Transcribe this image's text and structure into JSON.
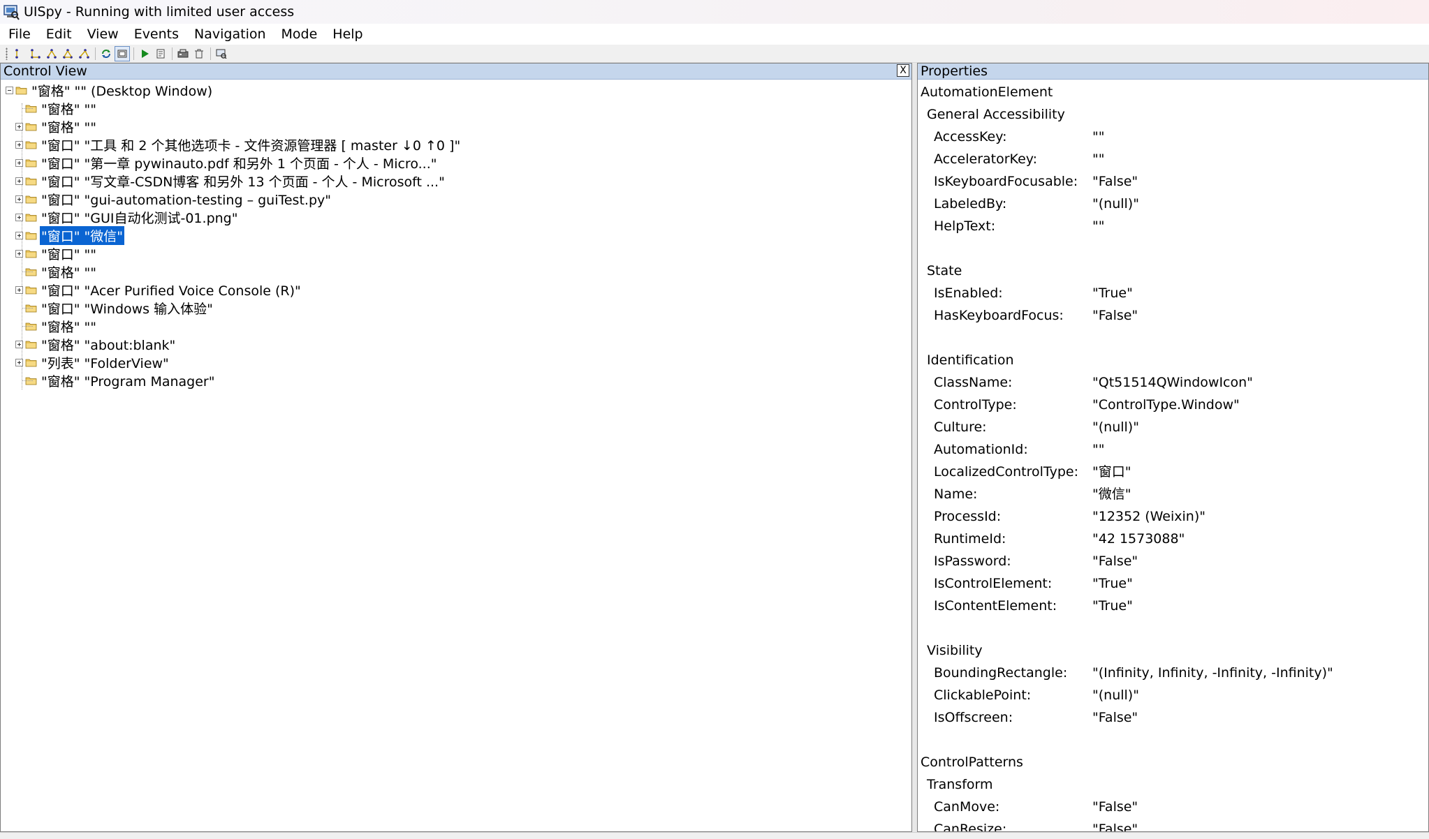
{
  "window": {
    "title": "UISpy - Running with limited user access"
  },
  "menu": [
    "File",
    "Edit",
    "View",
    "Events",
    "Navigation",
    "Mode",
    "Help"
  ],
  "control_view": {
    "header": "Control View",
    "close_label": "X",
    "tree": [
      {
        "label": "\"窗格\" \"\" (Desktop Window)",
        "level": 0,
        "expander": "minus"
      },
      {
        "label": "\"窗格\" \"\"",
        "level": 1,
        "expander": "none"
      },
      {
        "label": "\"窗格\" \"\"",
        "level": 1,
        "expander": "plus"
      },
      {
        "label": "\"窗口\" \"工具 和 2 个其他选项卡 - 文件资源管理器 [ master ↓0 ↑0 ]\"",
        "level": 1,
        "expander": "plus"
      },
      {
        "label": "\"窗口\" \"第一章 pywinauto.pdf 和另外 1 个页面 - 个人 - Micro...\"",
        "level": 1,
        "expander": "plus"
      },
      {
        "label": "\"窗口\" \"写文章-CSDN博客 和另外 13 个页面 - 个人 - Microsoft ...\"",
        "level": 1,
        "expander": "plus"
      },
      {
        "label": "\"窗口\" \"gui-automation-testing – guiTest.py\"",
        "level": 1,
        "expander": "plus"
      },
      {
        "label": "\"窗口\" \"GUI自动化测试-01.png\"",
        "level": 1,
        "expander": "plus"
      },
      {
        "label": "\"窗口\" \"微信\"",
        "level": 1,
        "expander": "plus",
        "selected": true
      },
      {
        "label": "\"窗口\" \"\"",
        "level": 1,
        "expander": "plus"
      },
      {
        "label": "\"窗格\" \"\"",
        "level": 1,
        "expander": "none"
      },
      {
        "label": "\"窗口\" \"Acer Purified Voice Console (R)\"",
        "level": 1,
        "expander": "plus"
      },
      {
        "label": "\"窗口\" \"Windows 输入体验\"",
        "level": 1,
        "expander": "none"
      },
      {
        "label": "\"窗格\" \"\"",
        "level": 1,
        "expander": "none"
      },
      {
        "label": "\"窗格\" \"about:blank\"",
        "level": 1,
        "expander": "plus"
      },
      {
        "label": "\"列表\" \"FolderView\"",
        "level": 1,
        "expander": "plus"
      },
      {
        "label": "\"窗格\" \"Program Manager\"",
        "level": 1,
        "expander": "none"
      }
    ]
  },
  "properties": {
    "header": "Properties",
    "rows": [
      {
        "kind": "group",
        "level": 0,
        "name": "AutomationElement"
      },
      {
        "kind": "group",
        "level": 1,
        "name": "General Accessibility"
      },
      {
        "kind": "prop",
        "name": "AccessKey:",
        "value": "\"\""
      },
      {
        "kind": "prop",
        "name": "AcceleratorKey:",
        "value": "\"\""
      },
      {
        "kind": "prop",
        "name": "IsKeyboardFocusable:",
        "value": "\"False\""
      },
      {
        "kind": "prop",
        "name": "LabeledBy:",
        "value": "\"(null)\""
      },
      {
        "kind": "prop",
        "name": "HelpText:",
        "value": "\"\""
      },
      {
        "kind": "gap"
      },
      {
        "kind": "group",
        "level": 1,
        "name": "State"
      },
      {
        "kind": "prop",
        "name": "IsEnabled:",
        "value": "\"True\""
      },
      {
        "kind": "prop",
        "name": "HasKeyboardFocus:",
        "value": "\"False\""
      },
      {
        "kind": "gap"
      },
      {
        "kind": "group",
        "level": 1,
        "name": "Identification"
      },
      {
        "kind": "prop",
        "name": "ClassName:",
        "value": "\"Qt51514QWindowIcon\""
      },
      {
        "kind": "prop",
        "name": "ControlType:",
        "value": "\"ControlType.Window\""
      },
      {
        "kind": "prop",
        "name": "Culture:",
        "value": "\"(null)\""
      },
      {
        "kind": "prop",
        "name": "AutomationId:",
        "value": "\"\""
      },
      {
        "kind": "prop",
        "name": "LocalizedControlType:",
        "value": "\"窗口\""
      },
      {
        "kind": "prop",
        "name": "Name:",
        "value": "\"微信\""
      },
      {
        "kind": "prop",
        "name": "ProcessId:",
        "value": "\"12352 (Weixin)\""
      },
      {
        "kind": "prop",
        "name": "RuntimeId:",
        "value": "\"42 1573088\""
      },
      {
        "kind": "prop",
        "name": "IsPassword:",
        "value": "\"False\""
      },
      {
        "kind": "prop",
        "name": "IsControlElement:",
        "value": "\"True\""
      },
      {
        "kind": "prop",
        "name": "IsContentElement:",
        "value": "\"True\""
      },
      {
        "kind": "gap"
      },
      {
        "kind": "group",
        "level": 1,
        "name": "Visibility"
      },
      {
        "kind": "prop",
        "name": "BoundingRectangle:",
        "value": "\"(Infinity, Infinity, -Infinity, -Infinity)\""
      },
      {
        "kind": "prop",
        "name": "ClickablePoint:",
        "value": "\"(null)\""
      },
      {
        "kind": "prop",
        "name": "IsOffscreen:",
        "value": "\"False\""
      },
      {
        "kind": "gap"
      },
      {
        "kind": "group",
        "level": 0,
        "name": "ControlPatterns"
      },
      {
        "kind": "group",
        "level": 1,
        "name": "Transform"
      },
      {
        "kind": "prop",
        "name": "CanMove:",
        "value": "\"False\""
      },
      {
        "kind": "prop",
        "name": "CanResize:",
        "value": "\"False\""
      }
    ]
  },
  "toolbar": {
    "buttons": [
      "tree-nav-parent-icon",
      "tree-nav-first-child-icon",
      "tree-nav-next-sibling-icon",
      "tree-nav-prev-sibling-icon",
      "tree-nav-last-child-icon",
      "refresh-icon",
      "focus-tracking-icon",
      "run-icon",
      "properties-icon",
      "hover-mode-icon",
      "delete-icon",
      "screenshot-icon"
    ]
  },
  "colors": {
    "selection": "#0a64d2",
    "pane_header": "#c5d6ec",
    "folder": "#e8c35a"
  }
}
